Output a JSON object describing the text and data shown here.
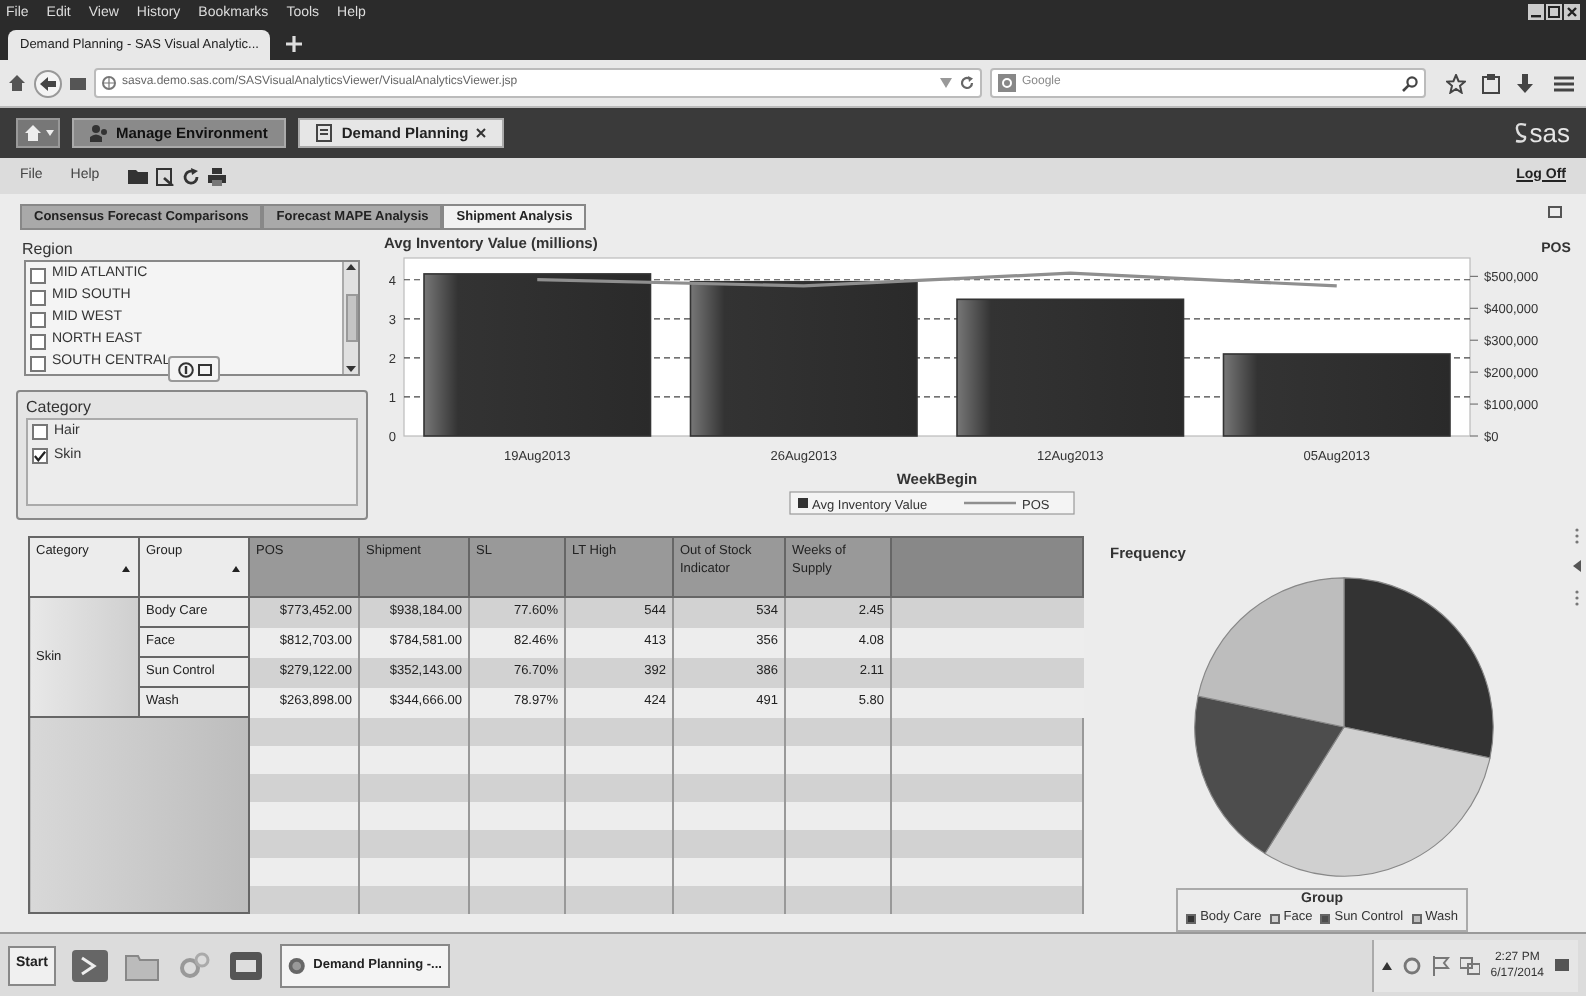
{
  "browser": {
    "menu": [
      "File",
      "Edit",
      "View",
      "History",
      "Bookmarks",
      "Tools",
      "Help"
    ],
    "tabs": [
      {
        "title": "Demand Planning - SAS Visual Analytic...",
        "selected": true
      }
    ],
    "url": "sasva.demo.sas.com/SASVisualAnalyticsViewer/VisualAnalyticsViewer.jsp",
    "search_placeholder": "Google"
  },
  "app_bar": {
    "buttons": [
      {
        "label": "Manage Environment",
        "selected": false
      },
      {
        "label": "Demand Planning",
        "selected": true
      }
    ],
    "logo": "sas"
  },
  "app_menu": {
    "items": [
      "File",
      "Help"
    ],
    "log_off": "Log Off"
  },
  "report_tabs": [
    {
      "label": "Consensus Forecast Comparisons",
      "selected": false
    },
    {
      "label": "Forecast MAPE Analysis",
      "selected": false
    },
    {
      "label": "Shipment Analysis",
      "selected": true
    }
  ],
  "region": {
    "title": "Region",
    "items": [
      {
        "label": "MID ATLANTIC",
        "checked": false
      },
      {
        "label": "MID SOUTH",
        "checked": false
      },
      {
        "label": "MID WEST",
        "checked": false
      },
      {
        "label": "NORTH EAST",
        "checked": false
      },
      {
        "label": "SOUTH CENTRAL",
        "checked": false
      }
    ]
  },
  "category": {
    "title": "Category",
    "items": [
      {
        "label": "Hair",
        "checked": false
      },
      {
        "label": "Skin",
        "checked": true
      }
    ]
  },
  "chart": {
    "chart_data": {
      "type": "bar",
      "title": "Avg Inventory Value (millions)",
      "xlabel": "WeekBegin",
      "y2label": "POS",
      "grid": true,
      "legend": "bottom",
      "categories": [
        "19Aug2013",
        "26Aug2013",
        "12Aug2013",
        "05Aug2013"
      ],
      "series": [
        {
          "name": "Avg Inventory Value",
          "color": "#333333",
          "values": [
            4.15,
            3.95,
            3.5,
            2.1
          ]
        },
        {
          "name": "POS",
          "color": "#8f8f8f",
          "type": "line",
          "axis": "y2",
          "values": [
            490000,
            470000,
            510000,
            470000
          ]
        }
      ],
      "ylim": [
        0,
        4.25
      ],
      "yticks": [
        0,
        1,
        2,
        3,
        4
      ],
      "y2lim": [
        0,
        520000
      ],
      "y2ticks": [
        {
          "value": 0,
          "label": "$0"
        },
        {
          "value": 100000,
          "label": "$100,000"
        },
        {
          "value": 200000,
          "label": "$200,000"
        },
        {
          "value": 300000,
          "label": "$300,000"
        },
        {
          "value": 400000,
          "label": "$400,000"
        },
        {
          "value": 500000,
          "label": "$500,000"
        }
      ]
    }
  },
  "table": {
    "columns": [
      {
        "label": "Category",
        "sorted": true
      },
      {
        "label": "Group",
        "sorted": true
      },
      {
        "label": "POS",
        "sorted": false
      },
      {
        "label": "Shipment",
        "sorted": false
      },
      {
        "label": "SL",
        "sorted": false
      },
      {
        "label": "LT High",
        "sorted": false
      },
      {
        "label": "Out of Stock Indicator",
        "sorted": false
      },
      {
        "label": "Weeks of Supply",
        "sorted": false
      }
    ],
    "groups": [
      {
        "category": "Skin",
        "rows": [
          {
            "cells": [
              "Body Care",
              "$773,452.00",
              "$938,184.00",
              "77.60%",
              "544",
              "534",
              "2.45"
            ]
          },
          {
            "cells": [
              "Face",
              "$812,703.00",
              "$784,581.00",
              "82.46%",
              "413",
              "356",
              "4.08"
            ]
          },
          {
            "cells": [
              "Sun Control",
              "$279,122.00",
              "$352,143.00",
              "76.70%",
              "392",
              "386",
              "2.11"
            ]
          },
          {
            "cells": [
              "Wash",
              "$263,898.00",
              "$344,666.00",
              "78.97%",
              "424",
              "491",
              "5.80"
            ]
          }
        ]
      }
    ]
  },
  "pie": {
    "title": "Frequency",
    "legend_title": "Group",
    "legend": [
      {
        "label": "Body Care",
        "color": "#333333"
      },
      {
        "label": "Face",
        "color": "#d0d0d0"
      },
      {
        "label": "Sun Control",
        "color": "#4d4d4d"
      },
      {
        "label": "Wash",
        "color": "#bdbdbd"
      }
    ]
  },
  "taskbar": {
    "start": "Start",
    "tasks": [
      {
        "label": "Demand Planning -...",
        "selected": true
      }
    ],
    "time": "2:27 PM",
    "date": "6/17/2014"
  }
}
